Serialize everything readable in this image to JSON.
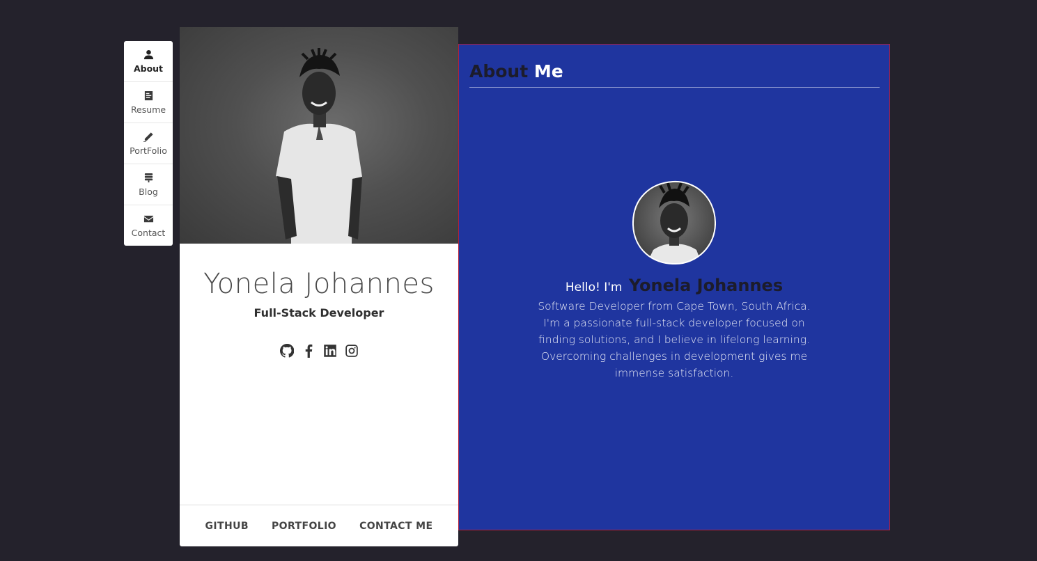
{
  "nav": {
    "items": [
      {
        "label": "About",
        "icon": "user-icon",
        "active": true
      },
      {
        "label": "Resume",
        "icon": "resume-icon",
        "active": false
      },
      {
        "label": "PortFolio",
        "icon": "pencil-icon",
        "active": false
      },
      {
        "label": "Blog",
        "icon": "blog-icon",
        "active": false
      },
      {
        "label": "Contact",
        "icon": "envelope-icon",
        "active": false
      }
    ]
  },
  "profile": {
    "name": "Yonela Johannes",
    "role": "Full-Stack Developer",
    "socials": [
      "github-icon",
      "facebook-icon",
      "linkedin-icon",
      "instagram-icon"
    ],
    "footer_links": [
      "GITHUB",
      "PORTFOLIO",
      "CONTACT ME"
    ]
  },
  "about": {
    "title_part1": "About",
    "title_part2": "Me",
    "greeting": "Hello! I'm",
    "name": "Yonela Johannes",
    "bio": "Software Developer from Cape Town, South Africa. I'm a passionate full-stack developer focused on finding solutions, and I believe in lifelong learning. Overcoming challenges in development gives me immense satisfaction."
  },
  "colors": {
    "background": "#24222c",
    "about_panel": "#1f359f",
    "accent_dark": "#1c1c2b",
    "panel_border": "#b0203f"
  }
}
